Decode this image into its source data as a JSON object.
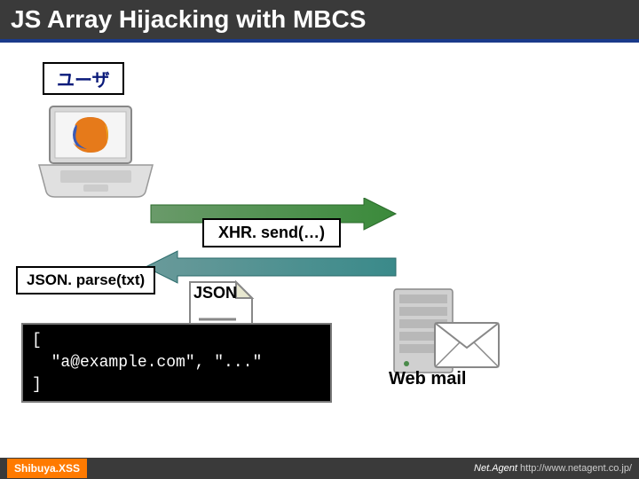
{
  "title": "JS Array Hijacking with MBCS",
  "user_label": "ユーザ",
  "xhr_label": "XHR. send(…)",
  "json_parse_label": "JSON. parse(txt)",
  "json_doc_label": "JSON",
  "code_block": "[\n  \"a@example.com\", \"...\"\n]",
  "webmail_label": "Web mail",
  "footer": {
    "left": "Shibuya.XSS",
    "right_brand": "Net.Agent",
    "right_url": " http://www.netagent.co.jp/"
  },
  "icons": {
    "laptop": "laptop-icon",
    "firefox": "firefox-icon",
    "document": "document-icon",
    "server": "server-icon",
    "envelope": "envelope-icon"
  }
}
